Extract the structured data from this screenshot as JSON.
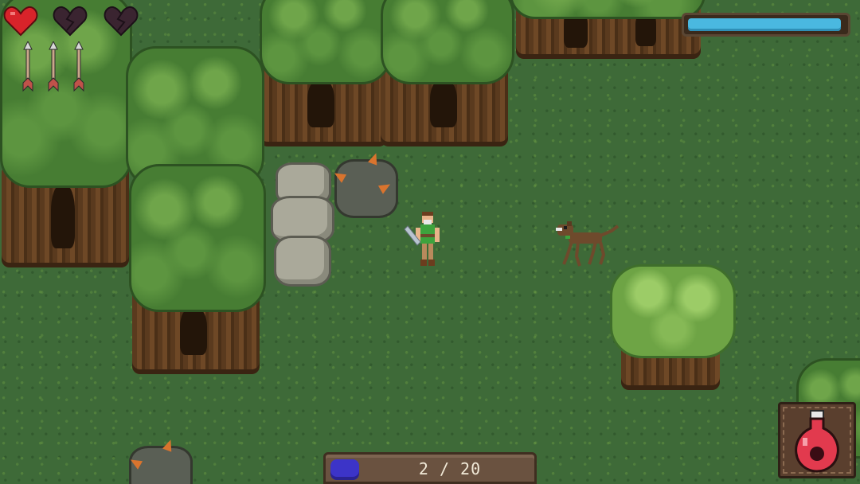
{
  "hud": {
    "hearts": {
      "max": 3,
      "full": 1
    },
    "arrows": {
      "count": 3
    },
    "mana_bar": {
      "fill_fraction": 0.98,
      "color": "#4ab8e0"
    },
    "collectibles": {
      "current": 2,
      "total": 20,
      "text": "2 / 20",
      "orb_color": "#3c34c8"
    },
    "item_slot": {
      "item": "health-potion-icon",
      "color": "#e23a4e"
    }
  },
  "world": {
    "player": "player-character",
    "enemy": "brown-hound-enemy"
  }
}
